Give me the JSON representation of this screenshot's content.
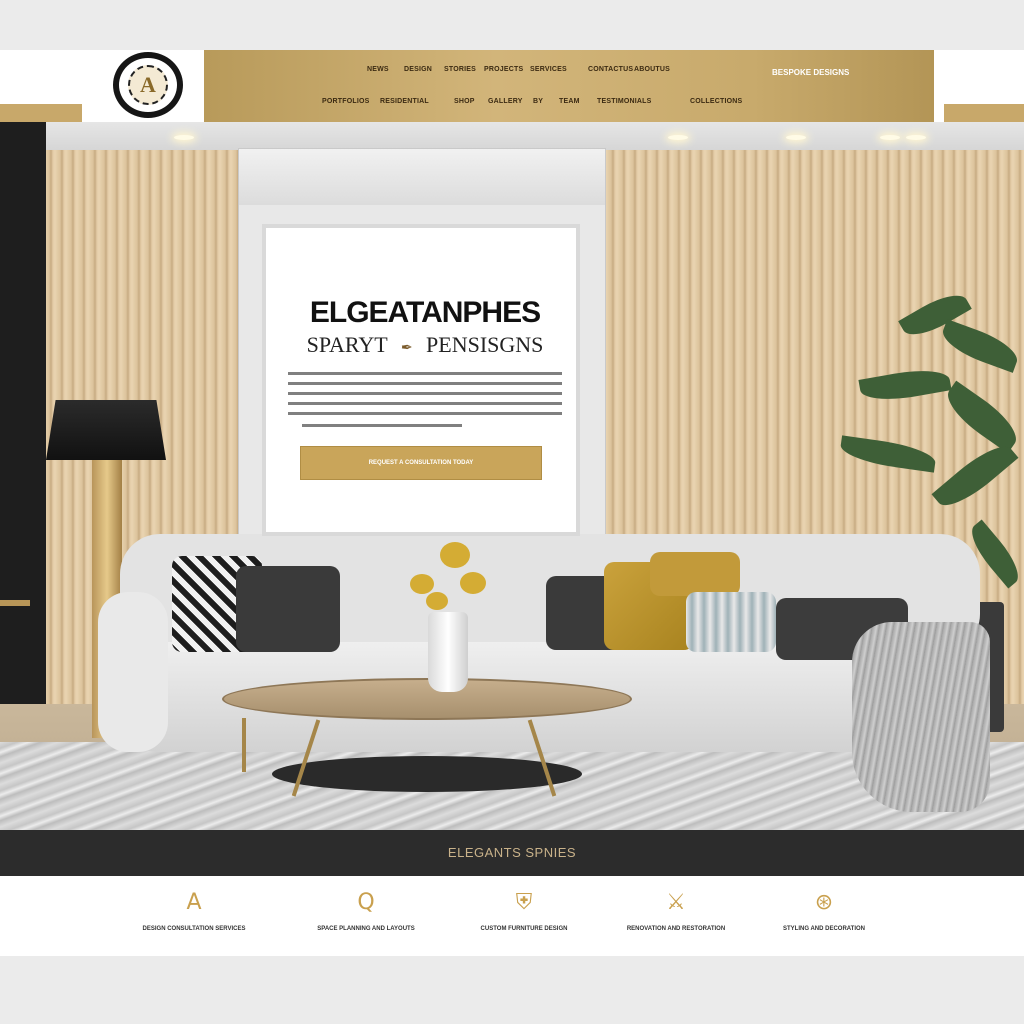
{
  "brand": {
    "logo_letter": "A",
    "logo_name": "logo-emblem"
  },
  "header": {
    "nav_row1": [
      "NEWS",
      "DESIGN",
      "STORIES",
      "PROJECTS",
      "SERVICES",
      "CONTACTUS",
      "ABOUTUS"
    ],
    "nav_row2": [
      "PORTFOLIOS",
      "RESIDENTIAL",
      "SHOP",
      "GALLERY",
      "BY",
      "TEAM",
      "TESTIMONIALS",
      "COLLECTIONS"
    ],
    "cta": "BESPOKE DESIGNS"
  },
  "hero": {
    "headline": "ELGEATANPHES",
    "subline": "SPARYT",
    "subline_right": "PENSISGNS",
    "cta_label": "REQUEST A CONSULTATION TODAY"
  },
  "band": {
    "title": "ELEGANTS SPNIES"
  },
  "features": [
    {
      "icon": "letter-a-icon",
      "glyph": "A",
      "label": "DESIGN CONSULTATION SERVICES"
    },
    {
      "icon": "magnifier-icon",
      "glyph": "Q",
      "label": "SPACE PLANNING AND LAYOUTS"
    },
    {
      "icon": "shield-icon",
      "glyph": "⛨",
      "label": "CUSTOM FURNITURE DESIGN"
    },
    {
      "icon": "crossed-tools-icon",
      "glyph": "⚔",
      "label": "RENOVATION AND RESTORATION"
    },
    {
      "icon": "compass-icon",
      "glyph": "⊛",
      "label": "STYLING AND DECORATION"
    }
  ],
  "colors": {
    "gold": "#c9a55a",
    "dark": "#2c2c2c",
    "accent_text": "#c9b28a"
  }
}
